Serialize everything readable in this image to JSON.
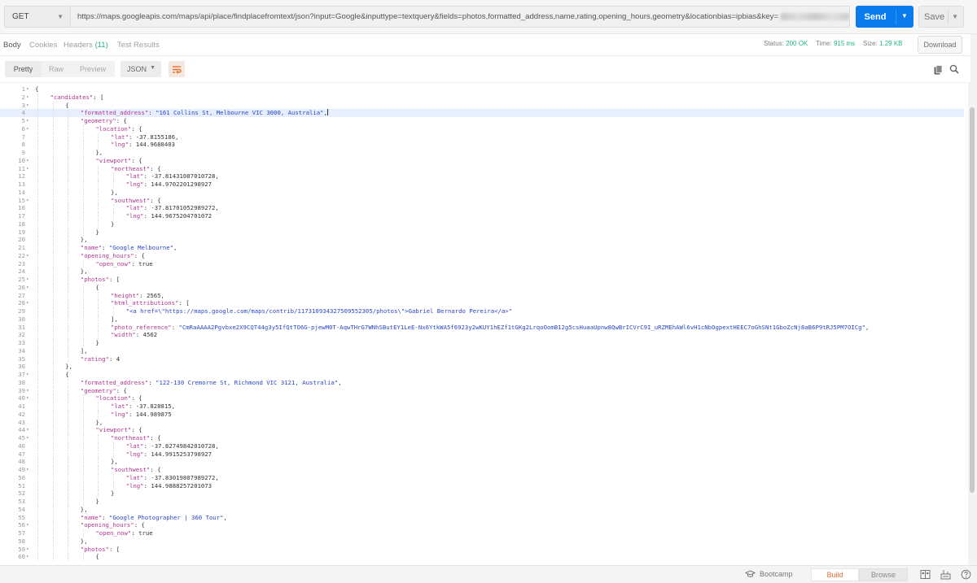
{
  "request": {
    "method": "GET",
    "url": "https://maps.googleapis.com/maps/api/place/findplacefromtext/json?input=Google&inputtype=textquery&fields=photos,formatted_address,name,rating,opening_hours,geometry&locationbias=ipbias&key=",
    "send_label": "Send",
    "save_label": "Save"
  },
  "response_tabs": [
    {
      "label": "Body",
      "active": true
    },
    {
      "label": "Cookies"
    },
    {
      "label": "Headers",
      "count": "(11)"
    },
    {
      "label": "Test Results"
    }
  ],
  "status": {
    "status_label": "Status:",
    "status_value": "200 OK",
    "time_label": "Time:",
    "time_value": "915 ms",
    "size_label": "Size:",
    "size_value": "1.29 KB"
  },
  "download_label": "Download",
  "view_modes": [
    "Pretty",
    "Raw",
    "Preview"
  ],
  "format": "JSON",
  "icons": {
    "wrap": "wrap-lines-icon",
    "copy": "copy-icon",
    "search": "search-icon"
  },
  "colors": {
    "accent": "#097bed",
    "success": "#26b47f",
    "key": "#b0368e",
    "string": "#2a47c9",
    "brand": "#f26b3a"
  },
  "code_lines": [
    {
      "n": 1,
      "fold": true,
      "indent": 0,
      "parts": [
        [
          "p",
          "{"
        ]
      ]
    },
    {
      "n": 2,
      "fold": true,
      "indent": 1,
      "parts": [
        [
          "k",
          "\"candidates\""
        ],
        [
          "p",
          ": ["
        ]
      ]
    },
    {
      "n": 3,
      "fold": true,
      "indent": 2,
      "parts": [
        [
          "p",
          "{"
        ]
      ]
    },
    {
      "n": 4,
      "indent": 3,
      "hl": true,
      "caret": true,
      "parts": [
        [
          "k",
          "\"formatted_address\""
        ],
        [
          "p",
          ": "
        ],
        [
          "s",
          "\"161 Collins St, Melbourne VIC 3000, Australia\""
        ],
        [
          "p",
          ","
        ]
      ]
    },
    {
      "n": 5,
      "fold": true,
      "indent": 3,
      "parts": [
        [
          "k",
          "\"geometry\""
        ],
        [
          "p",
          ": {"
        ]
      ]
    },
    {
      "n": 6,
      "fold": true,
      "indent": 4,
      "parts": [
        [
          "k",
          "\"location\""
        ],
        [
          "p",
          ": {"
        ]
      ]
    },
    {
      "n": 7,
      "indent": 5,
      "parts": [
        [
          "k",
          "\"lat\""
        ],
        [
          "p",
          ": -37.8155186,"
        ]
      ]
    },
    {
      "n": 8,
      "indent": 5,
      "parts": [
        [
          "k",
          "\"lng\""
        ],
        [
          "p",
          ": 144.9688403"
        ]
      ]
    },
    {
      "n": 9,
      "indent": 4,
      "parts": [
        [
          "p",
          "},"
        ]
      ]
    },
    {
      "n": 10,
      "fold": true,
      "indent": 4,
      "parts": [
        [
          "k",
          "\"viewport\""
        ],
        [
          "p",
          ": {"
        ]
      ]
    },
    {
      "n": 11,
      "fold": true,
      "indent": 5,
      "parts": [
        [
          "k",
          "\"northeast\""
        ],
        [
          "p",
          ": {"
        ]
      ]
    },
    {
      "n": 12,
      "indent": 6,
      "parts": [
        [
          "k",
          "\"lat\""
        ],
        [
          "p",
          ": -37.81431087010728,"
        ]
      ]
    },
    {
      "n": 13,
      "indent": 6,
      "parts": [
        [
          "k",
          "\"lng\""
        ],
        [
          "p",
          ": 144.9702201298927"
        ]
      ]
    },
    {
      "n": 14,
      "indent": 5,
      "parts": [
        [
          "p",
          "},"
        ]
      ]
    },
    {
      "n": 15,
      "fold": true,
      "indent": 5,
      "parts": [
        [
          "k",
          "\"southwest\""
        ],
        [
          "p",
          ": {"
        ]
      ]
    },
    {
      "n": 16,
      "indent": 6,
      "parts": [
        [
          "k",
          "\"lat\""
        ],
        [
          "p",
          ": -37.81701052989272,"
        ]
      ]
    },
    {
      "n": 17,
      "indent": 6,
      "parts": [
        [
          "k",
          "\"lng\""
        ],
        [
          "p",
          ": 144.9675204701072"
        ]
      ]
    },
    {
      "n": 18,
      "indent": 5,
      "parts": [
        [
          "p",
          "}"
        ]
      ]
    },
    {
      "n": 19,
      "indent": 4,
      "parts": [
        [
          "p",
          "}"
        ]
      ]
    },
    {
      "n": 20,
      "indent": 3,
      "parts": [
        [
          "p",
          "},"
        ]
      ]
    },
    {
      "n": 21,
      "indent": 3,
      "parts": [
        [
          "k",
          "\"name\""
        ],
        [
          "p",
          ": "
        ],
        [
          "s",
          "\"Google Melbourne\""
        ],
        [
          "p",
          ","
        ]
      ]
    },
    {
      "n": 22,
      "fold": true,
      "indent": 3,
      "parts": [
        [
          "k",
          "\"opening_hours\""
        ],
        [
          "p",
          ": {"
        ]
      ]
    },
    {
      "n": 23,
      "indent": 4,
      "parts": [
        [
          "k",
          "\"open_now\""
        ],
        [
          "p",
          ": true"
        ]
      ]
    },
    {
      "n": 24,
      "indent": 3,
      "parts": [
        [
          "p",
          "},"
        ]
      ]
    },
    {
      "n": 25,
      "fold": true,
      "indent": 3,
      "parts": [
        [
          "k",
          "\"photos\""
        ],
        [
          "p",
          ": ["
        ]
      ]
    },
    {
      "n": 26,
      "fold": true,
      "indent": 4,
      "parts": [
        [
          "p",
          "{"
        ]
      ]
    },
    {
      "n": 27,
      "indent": 5,
      "parts": [
        [
          "k",
          "\"height\""
        ],
        [
          "p",
          ": 2565,"
        ]
      ]
    },
    {
      "n": 28,
      "fold": true,
      "indent": 5,
      "parts": [
        [
          "k",
          "\"html_attributions\""
        ],
        [
          "p",
          ": ["
        ]
      ]
    },
    {
      "n": 29,
      "indent": 6,
      "parts": [
        [
          "s",
          "\"<a href=\\\"https://maps.google.com/maps/contrib/117310934327509552305/photos\\\">Gabriel Bernardo Pereira</a>\""
        ]
      ]
    },
    {
      "n": 30,
      "indent": 5,
      "parts": [
        [
          "p",
          "],"
        ]
      ]
    },
    {
      "n": 31,
      "indent": 5,
      "parts": [
        [
          "k",
          "\"photo_reference\""
        ],
        [
          "p",
          ": "
        ],
        [
          "s",
          "\"CmRaAAAA2Pgvbxe2X9CQT44g3y5IfQtTO6G-pjewM0T-AqwTHrG7WNhSButEY1LeE-Nx6YtkWA5f6923y2wKUY1hEZf1tGKg2LrqoOomB12g5csHuaaUpnw8QwBrICVrC9I_uRZMEhAWl6vH1cNbOgpextHEEC7oGhSNt1GboZcNj8aB6P9tRJ5PM7OICg\""
        ],
        [
          "p",
          ","
        ]
      ]
    },
    {
      "n": 32,
      "indent": 5,
      "parts": [
        [
          "k",
          "\"width\""
        ],
        [
          "p",
          ": 4562"
        ]
      ]
    },
    {
      "n": 33,
      "indent": 4,
      "parts": [
        [
          "p",
          "}"
        ]
      ]
    },
    {
      "n": 34,
      "indent": 3,
      "parts": [
        [
          "p",
          "],"
        ]
      ]
    },
    {
      "n": 35,
      "indent": 3,
      "parts": [
        [
          "k",
          "\"rating\""
        ],
        [
          "p",
          ": 4"
        ]
      ]
    },
    {
      "n": 36,
      "indent": 2,
      "parts": [
        [
          "p",
          "},"
        ]
      ]
    },
    {
      "n": 37,
      "fold": true,
      "indent": 2,
      "parts": [
        [
          "p",
          "{"
        ]
      ]
    },
    {
      "n": 38,
      "indent": 3,
      "parts": [
        [
          "k",
          "\"formatted_address\""
        ],
        [
          "p",
          ": "
        ],
        [
          "s",
          "\"122-130 Cremorne St, Richmond VIC 3121, Australia\""
        ],
        [
          "p",
          ","
        ]
      ]
    },
    {
      "n": 39,
      "fold": true,
      "indent": 3,
      "parts": [
        [
          "k",
          "\"geometry\""
        ],
        [
          "p",
          ": {"
        ]
      ]
    },
    {
      "n": 40,
      "fold": true,
      "indent": 4,
      "parts": [
        [
          "k",
          "\"location\""
        ],
        [
          "p",
          ": {"
        ]
      ]
    },
    {
      "n": 41,
      "indent": 5,
      "parts": [
        [
          "k",
          "\"lat\""
        ],
        [
          "p",
          ": -37.828815,"
        ]
      ]
    },
    {
      "n": 42,
      "indent": 5,
      "parts": [
        [
          "k",
          "\"lng\""
        ],
        [
          "p",
          ": 144.989875"
        ]
      ]
    },
    {
      "n": 43,
      "indent": 4,
      "parts": [
        [
          "p",
          "},"
        ]
      ]
    },
    {
      "n": 44,
      "fold": true,
      "indent": 4,
      "parts": [
        [
          "k",
          "\"viewport\""
        ],
        [
          "p",
          ": {"
        ]
      ]
    },
    {
      "n": 45,
      "fold": true,
      "indent": 5,
      "parts": [
        [
          "k",
          "\"northeast\""
        ],
        [
          "p",
          ": {"
        ]
      ]
    },
    {
      "n": 46,
      "indent": 6,
      "parts": [
        [
          "k",
          "\"lat\""
        ],
        [
          "p",
          ": -37.82749842010728,"
        ]
      ]
    },
    {
      "n": 47,
      "indent": 6,
      "parts": [
        [
          "k",
          "\"lng\""
        ],
        [
          "p",
          ": 144.9915253798927"
        ]
      ]
    },
    {
      "n": 48,
      "indent": 5,
      "parts": [
        [
          "p",
          "},"
        ]
      ]
    },
    {
      "n": 49,
      "fold": true,
      "indent": 5,
      "parts": [
        [
          "k",
          "\"southwest\""
        ],
        [
          "p",
          ": {"
        ]
      ]
    },
    {
      "n": 50,
      "indent": 6,
      "parts": [
        [
          "k",
          "\"lat\""
        ],
        [
          "p",
          ": -37.83019807989272,"
        ]
      ]
    },
    {
      "n": 51,
      "indent": 6,
      "parts": [
        [
          "k",
          "\"lng\""
        ],
        [
          "p",
          ": 144.9888257201073"
        ]
      ]
    },
    {
      "n": 52,
      "indent": 5,
      "parts": [
        [
          "p",
          "}"
        ]
      ]
    },
    {
      "n": 53,
      "indent": 4,
      "parts": [
        [
          "p",
          "}"
        ]
      ]
    },
    {
      "n": 54,
      "indent": 3,
      "parts": [
        [
          "p",
          "},"
        ]
      ]
    },
    {
      "n": 55,
      "indent": 3,
      "parts": [
        [
          "k",
          "\"name\""
        ],
        [
          "p",
          ": "
        ],
        [
          "s",
          "\"Google Photographer | 360 Tour\""
        ],
        [
          "p",
          ","
        ]
      ]
    },
    {
      "n": 56,
      "fold": true,
      "indent": 3,
      "parts": [
        [
          "k",
          "\"opening_hours\""
        ],
        [
          "p",
          ": {"
        ]
      ]
    },
    {
      "n": 57,
      "indent": 4,
      "parts": [
        [
          "k",
          "\"open_now\""
        ],
        [
          "p",
          ": true"
        ]
      ]
    },
    {
      "n": 58,
      "indent": 3,
      "parts": [
        [
          "p",
          "},"
        ]
      ]
    },
    {
      "n": 59,
      "fold": true,
      "indent": 3,
      "parts": [
        [
          "k",
          "\"photos\""
        ],
        [
          "p",
          ": ["
        ]
      ]
    },
    {
      "n": 60,
      "fold": true,
      "indent": 4,
      "parts": [
        [
          "p",
          "{"
        ]
      ]
    }
  ],
  "footer": {
    "bootcamp_label": "Bootcamp",
    "build_label": "Build",
    "browse_label": "Browse"
  }
}
